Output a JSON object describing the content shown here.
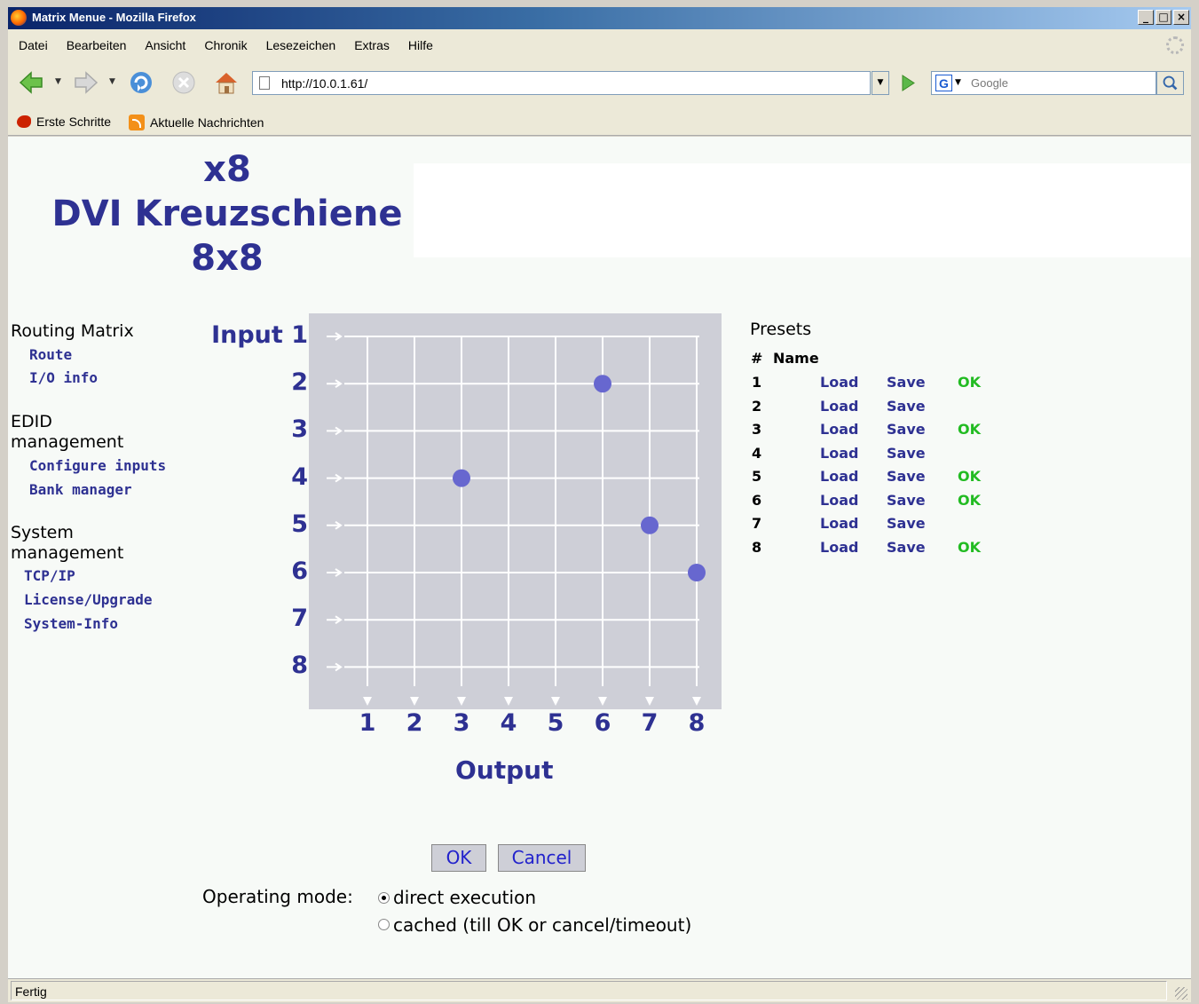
{
  "window": {
    "title": "Matrix Menue - Mozilla Firefox",
    "min": "_",
    "max": "□",
    "close": "×"
  },
  "menubar": {
    "items": [
      "Datei",
      "Bearbeiten",
      "Ansicht",
      "Chronik",
      "Lesezeichen",
      "Extras",
      "Hilfe"
    ]
  },
  "navbar": {
    "url": "http://10.0.1.61/",
    "search_placeholder": "Google"
  },
  "bookmarks": [
    "Erste Schritte",
    "Aktuelle Nachrichten"
  ],
  "logo": {
    "line1": "x8",
    "line2": "DVI Kreuzschiene",
    "line3": "8x8"
  },
  "sidenav": {
    "routing": {
      "title": "Routing Matrix",
      "links": [
        "Route",
        "I/O info"
      ]
    },
    "edid": {
      "title": "EDID management",
      "links": [
        "Configure inputs",
        "Bank manager"
      ]
    },
    "system": {
      "title": "System management",
      "links": [
        "TCP/IP",
        "License/Upgrade",
        "System-Info"
      ]
    }
  },
  "matrix": {
    "input_title": "Input",
    "inputs": [
      "1",
      "2",
      "3",
      "4",
      "5",
      "6",
      "7",
      "8"
    ],
    "outputs": [
      "1",
      "2",
      "3",
      "4",
      "5",
      "6",
      "7",
      "8"
    ],
    "output_title": "Output",
    "routes": [
      {
        "input": 2,
        "output": 6
      },
      {
        "input": 4,
        "output": 3
      },
      {
        "input": 5,
        "output": 7
      },
      {
        "input": 6,
        "output": 8
      }
    ],
    "colors": {
      "background": "#cecfd7",
      "grid": "#ffffff",
      "dot": "#6767cf",
      "labels": "#2e3192"
    }
  },
  "presets": {
    "title": "Presets",
    "col_num": "#",
    "col_name": "Name",
    "load_label": "Load",
    "save_label": "Save",
    "rows": [
      {
        "num": "1",
        "ok": "OK"
      },
      {
        "num": "2",
        "ok": ""
      },
      {
        "num": "3",
        "ok": "OK"
      },
      {
        "num": "4",
        "ok": ""
      },
      {
        "num": "5",
        "ok": "OK"
      },
      {
        "num": "6",
        "ok": "OK"
      },
      {
        "num": "7",
        "ok": ""
      },
      {
        "num": "8",
        "ok": "OK"
      }
    ]
  },
  "buttons": {
    "ok": "OK",
    "cancel": "Cancel"
  },
  "operating_mode": {
    "label": "Operating mode:",
    "options": [
      {
        "label": "direct execution",
        "selected": true
      },
      {
        "label": "cached (till OK or cancel/timeout)",
        "selected": false
      }
    ]
  },
  "status": {
    "text": "Fertig"
  }
}
